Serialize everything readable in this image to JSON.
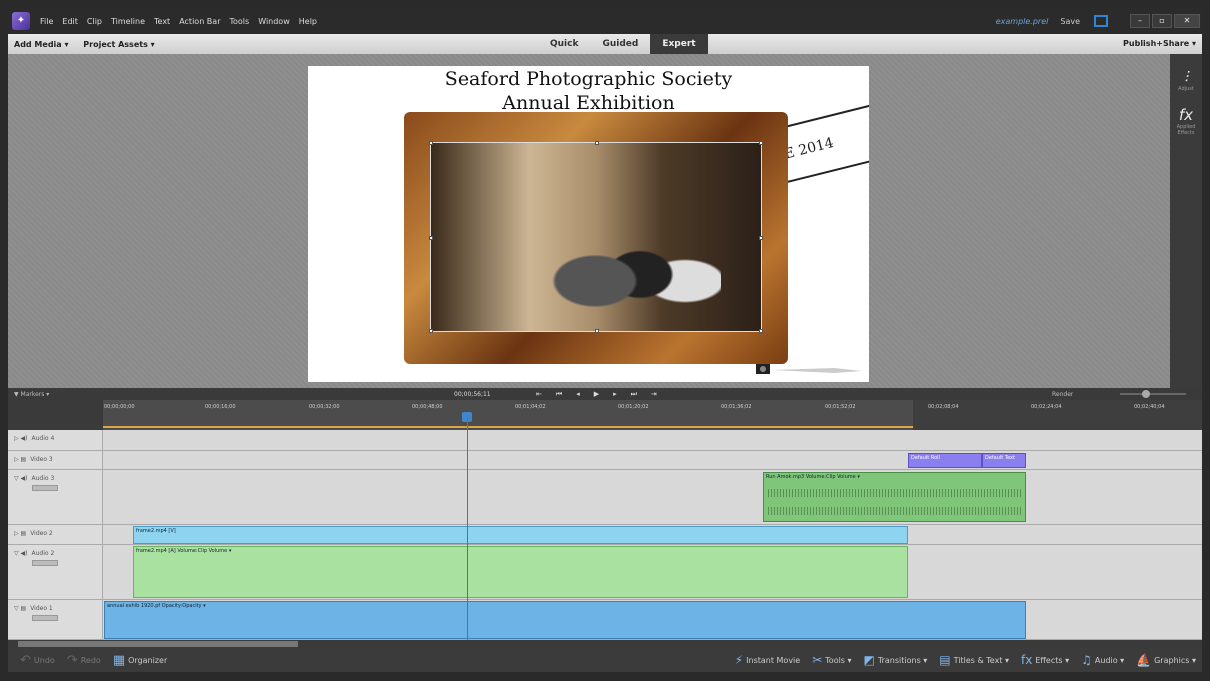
{
  "menu": [
    "File",
    "Edit",
    "Clip",
    "Timeline",
    "Text",
    "Action Bar",
    "Tools",
    "Window",
    "Help"
  ],
  "title_bar": {
    "filename": "example.prel",
    "save": "Save",
    "minimize": "–",
    "maximize": "▫",
    "close": "✕"
  },
  "mode_bar": {
    "add_media": "Add Media ▾",
    "project_assets": "Project Assets ▾",
    "modes": [
      "Quick",
      "Guided",
      "Expert"
    ],
    "active_mode": "Expert",
    "publish": "Publish+Share ▾"
  },
  "right_panel": {
    "adjust": "Adjust",
    "applied_effects": "Applied Effects"
  },
  "monitor": {
    "title_line1": "Seaford Photographic Society",
    "title_line2": "Annual Exhibition",
    "stamp": "IE 2014"
  },
  "timeline_bar": {
    "markers": "▼ Markers ▾",
    "timecode": "00;00;56;11",
    "render": "Render"
  },
  "ruler": [
    "00;00;00;00",
    "00;00;16;00",
    "00;00;32;00",
    "00;00;48;00",
    "00;01;04;02",
    "00;01;20;02",
    "00;01;36;02",
    "00;01;52;02",
    "00;02;08;04",
    "00;02;24;04",
    "00;02;40;04"
  ],
  "tracks": {
    "audio4": "Audio 4",
    "video3": "Video 3",
    "audio3": "Audio 3",
    "video2": "Video 2",
    "audio2": "Audio 2",
    "video1": "Video 1"
  },
  "clips": {
    "default_roll": "Default Roll",
    "default_text": "Default Text",
    "run_amok": "Run Amok.mp3 Volume:Clip Volume ▾",
    "frame2_v": "frame2.mp4 [V]",
    "frame2_a": "frame2.mp4 [A] Volume:Clip Volume ▾",
    "annual": "annual exhib 1920.pf  Opacity:Opacity ▾"
  },
  "action_bar": {
    "undo": "Undo",
    "redo": "Redo",
    "organizer": "Organizer",
    "instant_movie": "Instant Movie",
    "tools": "Tools ▾",
    "transitions": "Transitions ▾",
    "titles_text": "Titles & Text ▾",
    "effects": "Effects ▾",
    "audio": "Audio ▾",
    "graphics": "Graphics ▾"
  }
}
